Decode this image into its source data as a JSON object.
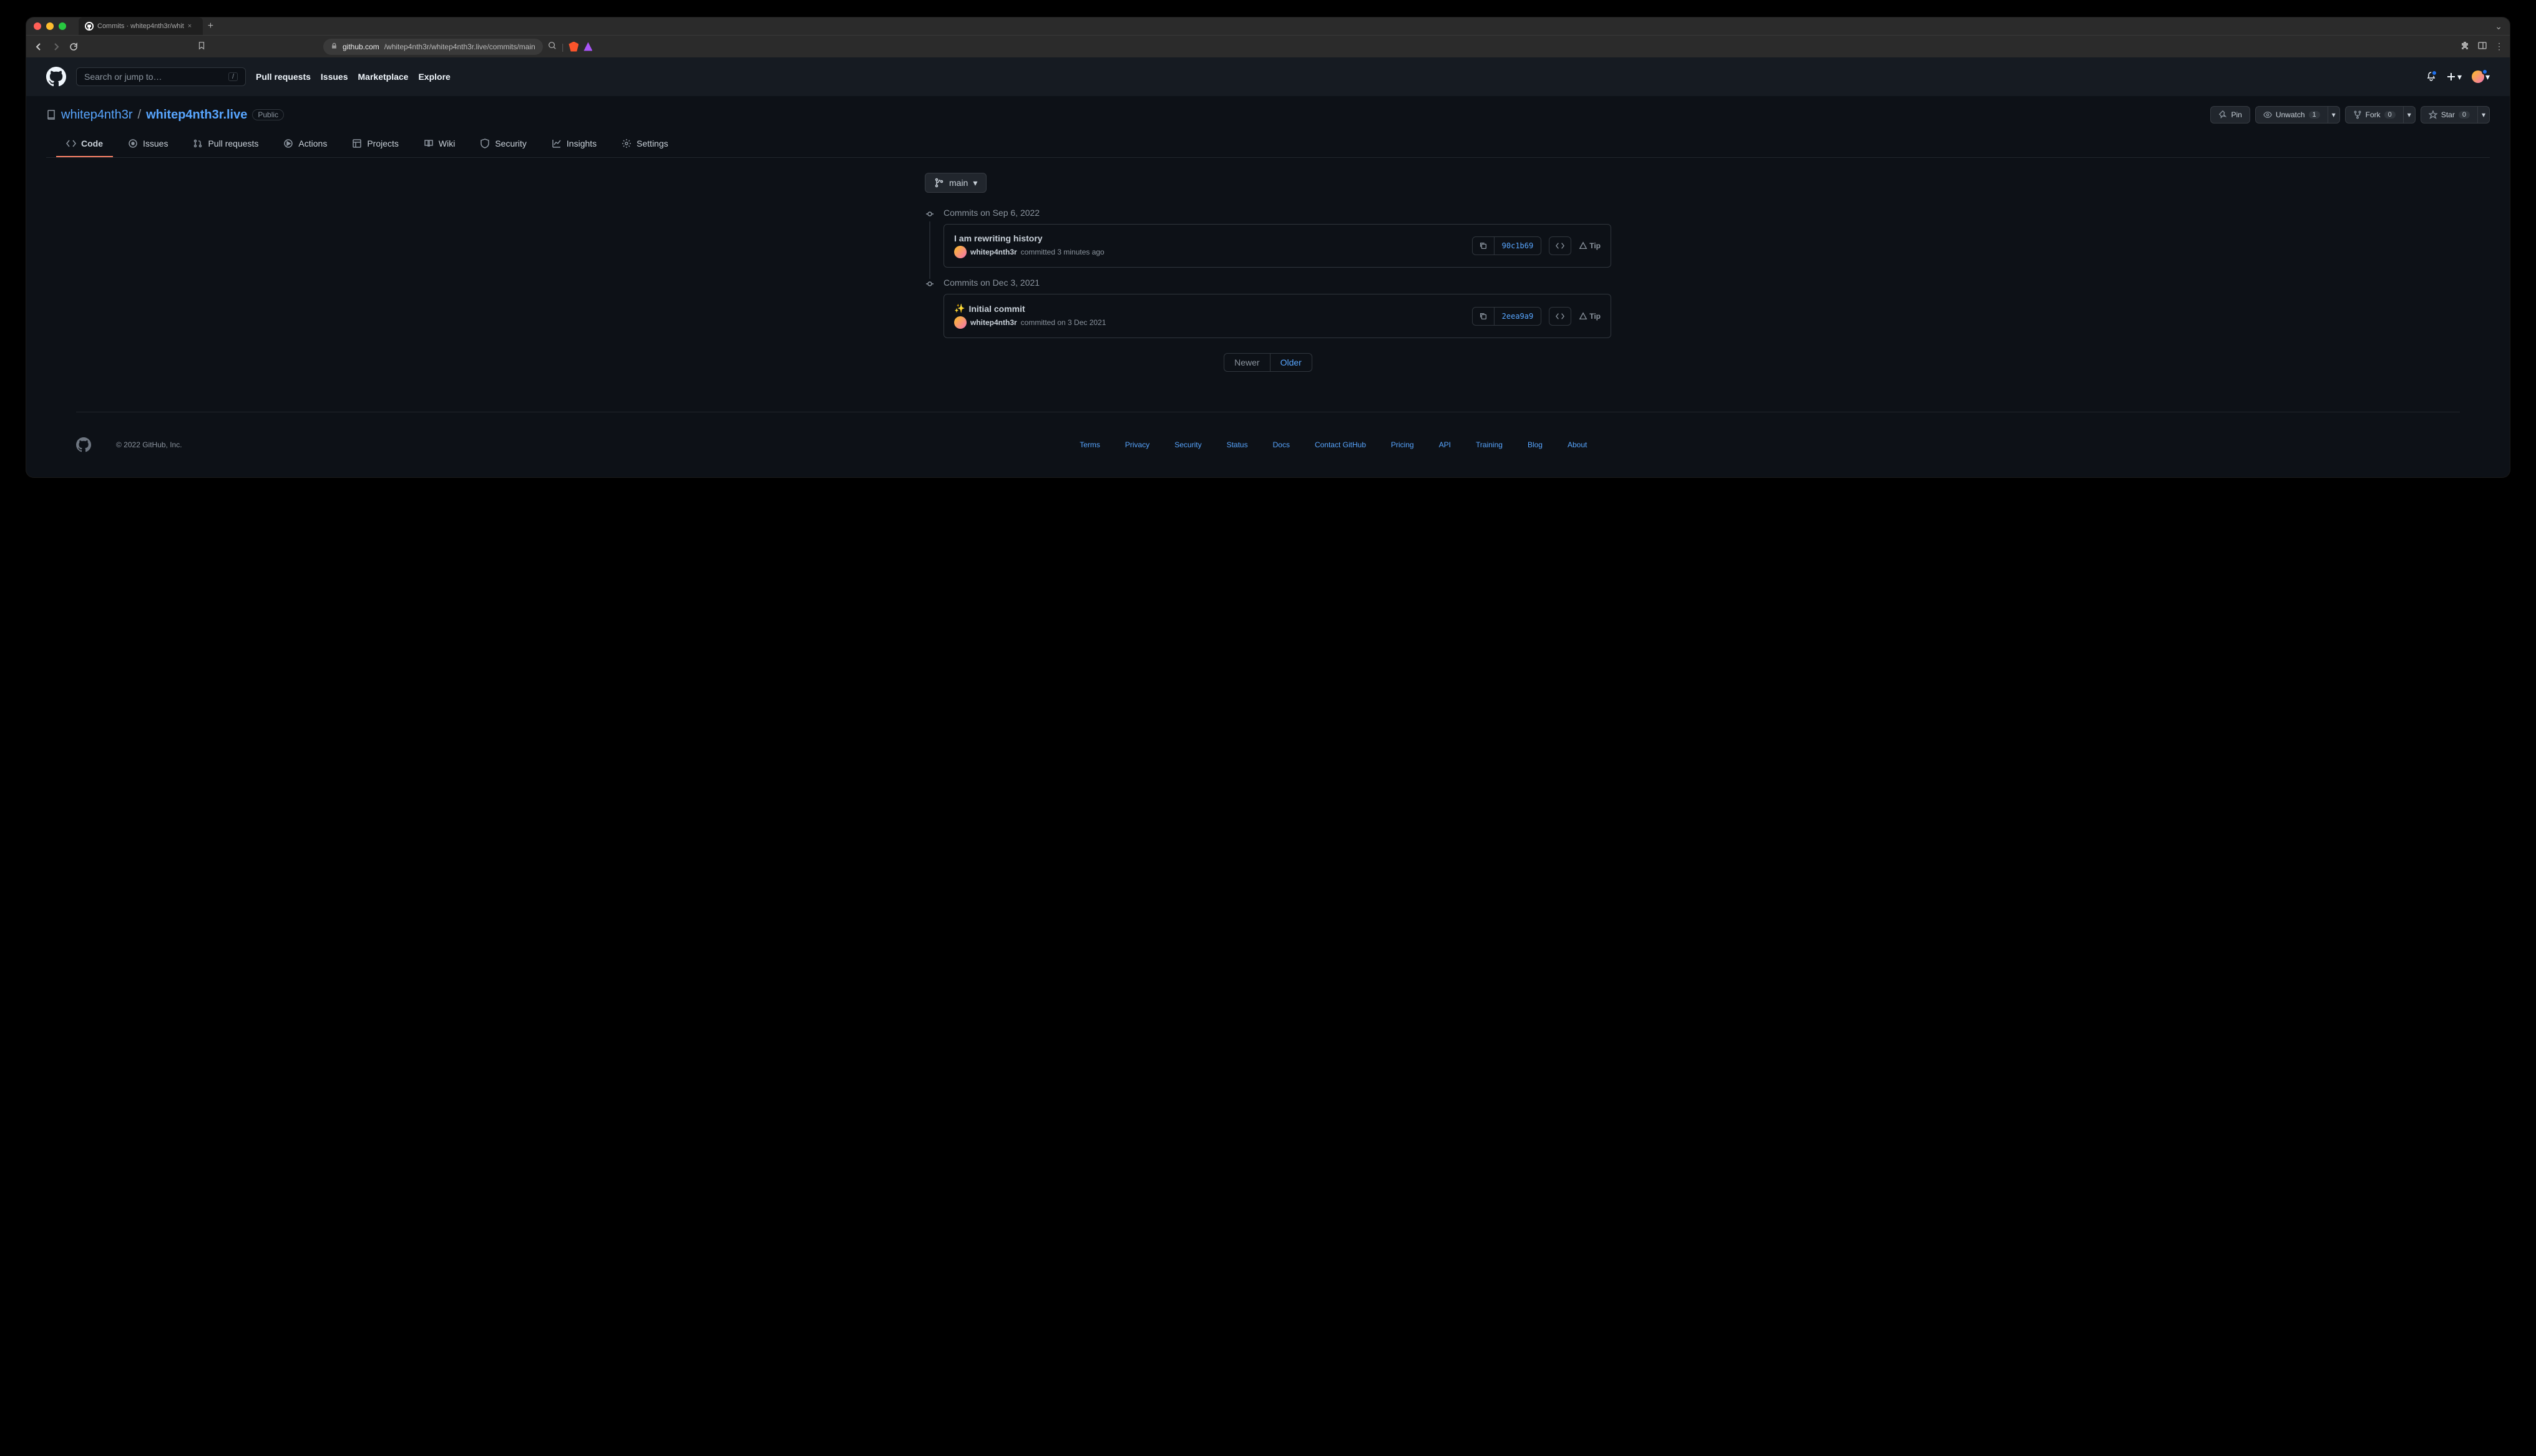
{
  "browser": {
    "tab_title": "Commits · whitep4nth3r/whit",
    "url_domain": "github.com",
    "url_path": "/whitep4nth3r/whitep4nth3r.live/commits/main"
  },
  "header": {
    "search_placeholder": "Search or jump to…",
    "search_key": "/",
    "nav": [
      "Pull requests",
      "Issues",
      "Marketplace",
      "Explore"
    ]
  },
  "repo": {
    "owner": "whitep4nth3r",
    "name": "whitep4nth3r.live",
    "visibility": "Public",
    "actions": {
      "pin": "Pin",
      "unwatch": "Unwatch",
      "watch_count": "1",
      "fork": "Fork",
      "fork_count": "0",
      "star": "Star",
      "star_count": "0"
    },
    "tabs": [
      "Code",
      "Issues",
      "Pull requests",
      "Actions",
      "Projects",
      "Wiki",
      "Security",
      "Insights",
      "Settings"
    ]
  },
  "commits": {
    "branch": "main",
    "groups": [
      {
        "date_label": "Commits on Sep 6, 2022",
        "items": [
          {
            "message": "I am rewriting history",
            "author": "whitep4nth3r",
            "meta": "committed 3 minutes ago",
            "sha": "90c1b69",
            "tip": "Tip"
          }
        ]
      },
      {
        "date_label": "Commits on Dec 3, 2021",
        "items": [
          {
            "emoji": "✨",
            "message": "Initial commit",
            "author": "whitep4nth3r",
            "meta": "committed on 3 Dec 2021",
            "sha": "2eea9a9",
            "tip": "Tip"
          }
        ]
      }
    ],
    "pager": {
      "newer": "Newer",
      "older": "Older"
    }
  },
  "footer": {
    "copyright": "© 2022 GitHub, Inc.",
    "links": [
      "Terms",
      "Privacy",
      "Security",
      "Status",
      "Docs",
      "Contact GitHub",
      "Pricing",
      "API",
      "Training",
      "Blog",
      "About"
    ]
  }
}
